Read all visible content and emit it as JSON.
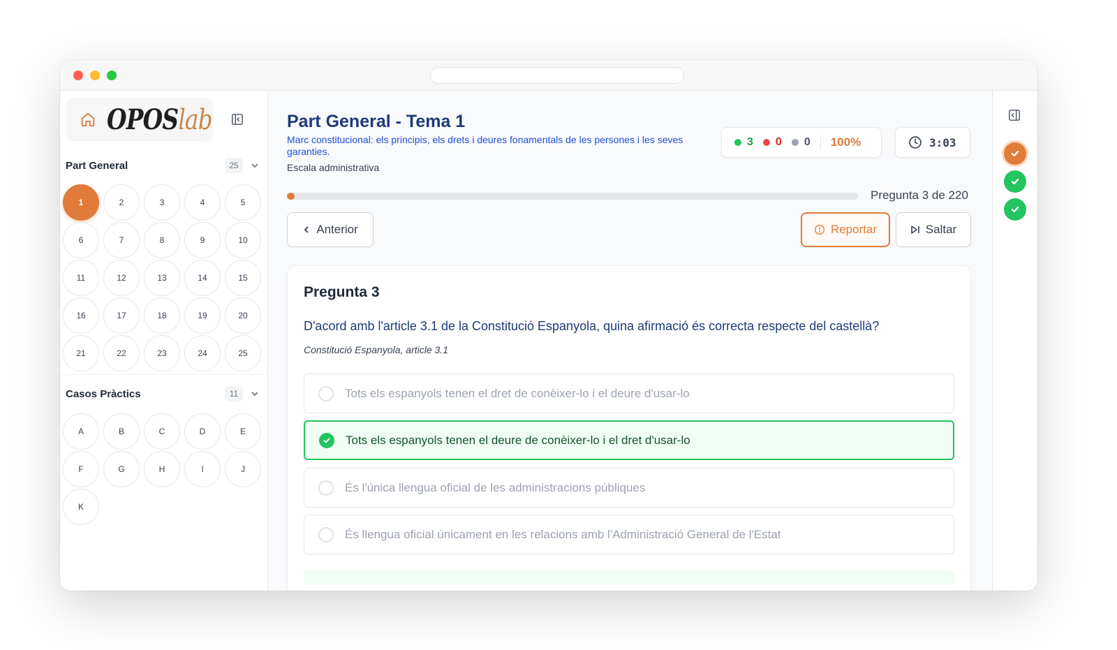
{
  "brand": {
    "name_part1": "OPOS",
    "name_part2": "lab"
  },
  "sections": [
    {
      "title": "Part General",
      "count": "25",
      "items": [
        "1",
        "2",
        "3",
        "4",
        "5",
        "6",
        "7",
        "8",
        "9",
        "10",
        "11",
        "12",
        "13",
        "14",
        "15",
        "16",
        "17",
        "18",
        "19",
        "20",
        "21",
        "22",
        "23",
        "24",
        "25"
      ],
      "active": "1"
    },
    {
      "title": "Casos Pràctics",
      "count": "11",
      "items": [
        "A",
        "B",
        "C",
        "D",
        "E",
        "F",
        "G",
        "H",
        "I",
        "J",
        "K"
      ]
    }
  ],
  "header": {
    "title": "Part General - Tema 1",
    "subtitle": "Marc constitucional: els principis, els drets i deures fonamentals de les persones i les seves garanties.",
    "scale": "Escala administrativa"
  },
  "stats": {
    "correct": "3",
    "wrong": "0",
    "blank": "0",
    "percent": "100%"
  },
  "timer": "3:03",
  "progress": {
    "label": "Pregunta 3 de 220",
    "fraction": 0.0136
  },
  "buttons": {
    "prev": "Anterior",
    "report": "Reportar",
    "skip": "Saltar"
  },
  "question": {
    "label": "Pregunta 3",
    "text": "D'acord amb l'article 3.1 de la Constitució Espanyola, quina afirmació és correcta respecte del castellà?",
    "source": "Constitució Espanyola, article 3.1",
    "options": [
      "Tots els espanyols tenen el dret de conèixer-lo i el deure d'usar-lo",
      "Tots els espanyols tenen el deure de conèixer-lo i el dret d'usar-lo",
      "És l'única llengua oficial de les administracions públiques",
      "És llengua oficial únicament en les relacions amb l'Administració General de l'Estat"
    ],
    "selected_index": 1
  },
  "history": [
    "current",
    "correct",
    "correct"
  ],
  "colors": {
    "accent": "#e07b39",
    "title": "#1e3a7b",
    "link": "#1d4ed8",
    "correct": "#22c55e",
    "wrong": "#ef4444"
  },
  "icons": [
    "home-icon",
    "sidebar-collapse-icon",
    "chevron-down-icon",
    "clock-icon",
    "chevron-left-icon",
    "alert-circle-icon",
    "skip-forward-icon",
    "check-icon"
  ]
}
